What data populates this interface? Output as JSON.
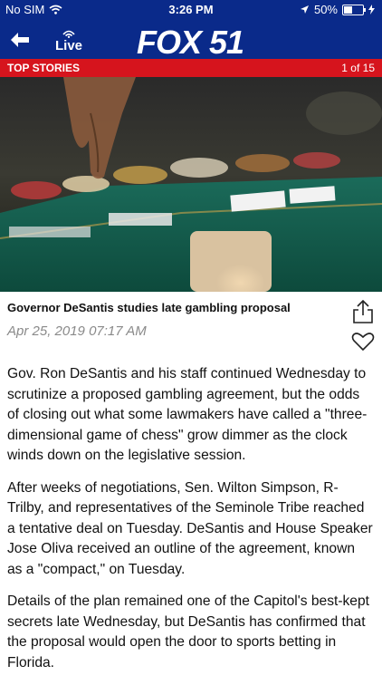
{
  "status_bar": {
    "carrier": "No SIM",
    "time": "3:26 PM",
    "battery_percent": "50%",
    "battery_level": 0.5
  },
  "app_bar": {
    "live_label": "Live",
    "logo_text": "FOX 51",
    "back_icon": "back-arrow-icon",
    "live_icon": "broadcast-icon"
  },
  "section_bar": {
    "label": "TOP STORIES",
    "counter": "1 of 15"
  },
  "article": {
    "headline": "Governor DeSantis studies late gambling proposal",
    "date": "Apr 25, 2019 07:17 AM",
    "paragraphs": [
      "Gov. Ron DeSantis and his staff continued Wednesday to scrutinize a proposed gambling agreement, but the odds of closing out what some lawmakers have called a \"three-dimensional game of chess\" grow dimmer as the clock winds down on the legislative session.",
      "After weeks of negotiations, Sen. Wilton Simpson, R-Trilby, and representatives of the Seminole Tribe reached a tentative deal on Tuesday. DeSantis and House Speaker Jose Oliva received an outline of the agreement, known as a \"compact,\" on Tuesday.",
      "Details of the plan remained one of the Capitol's best-kept secrets late Wednesday, but DeSantis has confirmed that the proposal would open the door to sports betting in Florida."
    ]
  },
  "colors": {
    "brand_blue": "#0a2a8a",
    "accent_red": "#d6141d"
  }
}
